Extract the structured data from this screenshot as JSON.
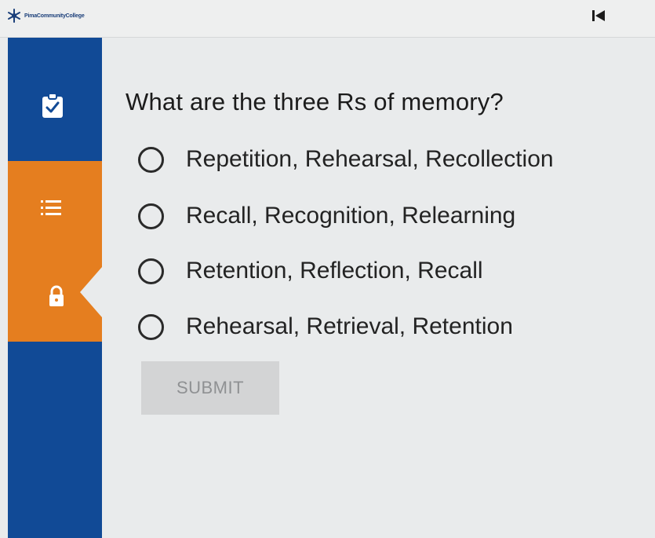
{
  "header": {
    "logo_text": "PimaCommunityCollege",
    "back_icon": "skip-back-icon"
  },
  "sidebar": {
    "colors": {
      "primary": "#114a96",
      "active": "#e57e1f"
    },
    "items": [
      {
        "icon": "clipboard-check-icon"
      },
      {
        "icon": "list-icon"
      },
      {
        "icon": "lock-icon"
      }
    ]
  },
  "question": {
    "text": "What are the three Rs of memory?",
    "options": [
      {
        "label": "Repetition, Rehearsal, Recollection",
        "selected": false
      },
      {
        "label": "Recall, Recognition, Relearning",
        "selected": false
      },
      {
        "label": "Retention, Reflection, Recall",
        "selected": false
      },
      {
        "label": "Rehearsal, Retrieval, Retention",
        "selected": false
      }
    ]
  },
  "submit": {
    "label": "SUBMIT",
    "enabled": false
  }
}
